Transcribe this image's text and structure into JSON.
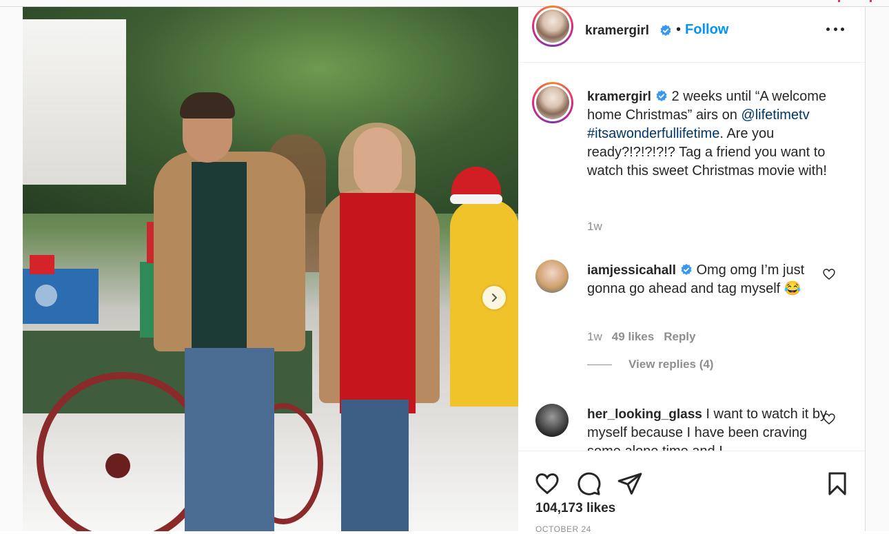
{
  "post": {
    "username": "kramergirl",
    "follow_label": "Follow",
    "caption": {
      "text_before": "2 weeks until “A welcome home Christmas” airs on ",
      "mention": "@lifetimetv",
      "hashtag": "#itsawonderfullifetime",
      "text_after": ". Are you ready?!?!?!?!? Tag a friend you want to watch this sweet Christmas movie with!",
      "time": "1w"
    },
    "comments": [
      {
        "username": "iamjessicahall",
        "text": "Omg omg I’m just gonna go ahead and tag myself 😂",
        "time": "1w",
        "likes": "49 likes",
        "reply_label": "Reply",
        "view_replies": "View replies (4)"
      },
      {
        "username": "her_looking_glass",
        "text": "I want to watch it by myself because I have been craving some alone time and I"
      }
    ],
    "likes_count": "104,173 likes",
    "date": "OCTOBER 24"
  },
  "icons": {
    "verified": "verified-badge-icon",
    "more": "more-options-icon",
    "like": "heart-icon",
    "comment": "comment-icon",
    "share": "paper-plane-icon",
    "save": "bookmark-icon",
    "next": "chevron-right-icon"
  },
  "colors": {
    "accent": "#0095f6",
    "link": "#00376b",
    "secondary_text": "#8e8e8e",
    "verified": "#3897f0"
  }
}
